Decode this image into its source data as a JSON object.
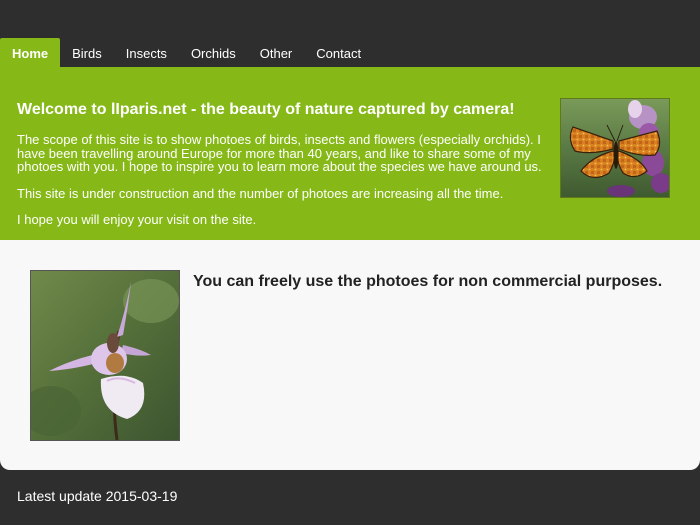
{
  "nav": {
    "items": [
      {
        "label": "Home",
        "active": true
      },
      {
        "label": "Birds",
        "active": false
      },
      {
        "label": "Insects",
        "active": false
      },
      {
        "label": "Orchids",
        "active": false
      },
      {
        "label": "Other",
        "active": false
      },
      {
        "label": "Contact",
        "active": false
      }
    ]
  },
  "intro": {
    "title": "Welcome to lIparis.net - the beauty of nature captured by camera!",
    "paragraph1": "The scope of this site is to show photoes of birds, insects and flowers (especially orchids). I have been travelling around Europe for more than 40 years, and like to share some of my photoes with you. I hope to inspire you to learn more about the species we have around us.",
    "paragraph2": "This site is under construction and the number of photoes are increasing all the time.",
    "paragraph3": "I hope you will enjoy your visit on the site."
  },
  "content": {
    "usage_note": "You can freely use the photoes for non commercial purposes."
  },
  "footer": {
    "update_text": "Latest update 2015-03-19"
  },
  "colors": {
    "page_background": "#2e2e2e",
    "accent_green": "#86b817",
    "content_background": "#f8f8f8",
    "text_dark": "#222222",
    "text_light": "#ffffff"
  }
}
